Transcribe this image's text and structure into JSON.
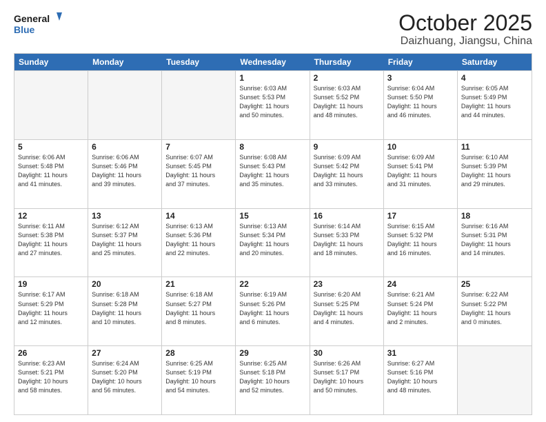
{
  "header": {
    "logo_line1": "General",
    "logo_line2": "Blue",
    "month": "October 2025",
    "location": "Daizhuang, Jiangsu, China"
  },
  "weekdays": [
    "Sunday",
    "Monday",
    "Tuesday",
    "Wednesday",
    "Thursday",
    "Friday",
    "Saturday"
  ],
  "weeks": [
    [
      {
        "day": "",
        "info": ""
      },
      {
        "day": "",
        "info": ""
      },
      {
        "day": "",
        "info": ""
      },
      {
        "day": "1",
        "info": "Sunrise: 6:03 AM\nSunset: 5:53 PM\nDaylight: 11 hours\nand 50 minutes."
      },
      {
        "day": "2",
        "info": "Sunrise: 6:03 AM\nSunset: 5:52 PM\nDaylight: 11 hours\nand 48 minutes."
      },
      {
        "day": "3",
        "info": "Sunrise: 6:04 AM\nSunset: 5:50 PM\nDaylight: 11 hours\nand 46 minutes."
      },
      {
        "day": "4",
        "info": "Sunrise: 6:05 AM\nSunset: 5:49 PM\nDaylight: 11 hours\nand 44 minutes."
      }
    ],
    [
      {
        "day": "5",
        "info": "Sunrise: 6:06 AM\nSunset: 5:48 PM\nDaylight: 11 hours\nand 41 minutes."
      },
      {
        "day": "6",
        "info": "Sunrise: 6:06 AM\nSunset: 5:46 PM\nDaylight: 11 hours\nand 39 minutes."
      },
      {
        "day": "7",
        "info": "Sunrise: 6:07 AM\nSunset: 5:45 PM\nDaylight: 11 hours\nand 37 minutes."
      },
      {
        "day": "8",
        "info": "Sunrise: 6:08 AM\nSunset: 5:43 PM\nDaylight: 11 hours\nand 35 minutes."
      },
      {
        "day": "9",
        "info": "Sunrise: 6:09 AM\nSunset: 5:42 PM\nDaylight: 11 hours\nand 33 minutes."
      },
      {
        "day": "10",
        "info": "Sunrise: 6:09 AM\nSunset: 5:41 PM\nDaylight: 11 hours\nand 31 minutes."
      },
      {
        "day": "11",
        "info": "Sunrise: 6:10 AM\nSunset: 5:39 PM\nDaylight: 11 hours\nand 29 minutes."
      }
    ],
    [
      {
        "day": "12",
        "info": "Sunrise: 6:11 AM\nSunset: 5:38 PM\nDaylight: 11 hours\nand 27 minutes."
      },
      {
        "day": "13",
        "info": "Sunrise: 6:12 AM\nSunset: 5:37 PM\nDaylight: 11 hours\nand 25 minutes."
      },
      {
        "day": "14",
        "info": "Sunrise: 6:13 AM\nSunset: 5:36 PM\nDaylight: 11 hours\nand 22 minutes."
      },
      {
        "day": "15",
        "info": "Sunrise: 6:13 AM\nSunset: 5:34 PM\nDaylight: 11 hours\nand 20 minutes."
      },
      {
        "day": "16",
        "info": "Sunrise: 6:14 AM\nSunset: 5:33 PM\nDaylight: 11 hours\nand 18 minutes."
      },
      {
        "day": "17",
        "info": "Sunrise: 6:15 AM\nSunset: 5:32 PM\nDaylight: 11 hours\nand 16 minutes."
      },
      {
        "day": "18",
        "info": "Sunrise: 6:16 AM\nSunset: 5:31 PM\nDaylight: 11 hours\nand 14 minutes."
      }
    ],
    [
      {
        "day": "19",
        "info": "Sunrise: 6:17 AM\nSunset: 5:29 PM\nDaylight: 11 hours\nand 12 minutes."
      },
      {
        "day": "20",
        "info": "Sunrise: 6:18 AM\nSunset: 5:28 PM\nDaylight: 11 hours\nand 10 minutes."
      },
      {
        "day": "21",
        "info": "Sunrise: 6:18 AM\nSunset: 5:27 PM\nDaylight: 11 hours\nand 8 minutes."
      },
      {
        "day": "22",
        "info": "Sunrise: 6:19 AM\nSunset: 5:26 PM\nDaylight: 11 hours\nand 6 minutes."
      },
      {
        "day": "23",
        "info": "Sunrise: 6:20 AM\nSunset: 5:25 PM\nDaylight: 11 hours\nand 4 minutes."
      },
      {
        "day": "24",
        "info": "Sunrise: 6:21 AM\nSunset: 5:24 PM\nDaylight: 11 hours\nand 2 minutes."
      },
      {
        "day": "25",
        "info": "Sunrise: 6:22 AM\nSunset: 5:22 PM\nDaylight: 11 hours\nand 0 minutes."
      }
    ],
    [
      {
        "day": "26",
        "info": "Sunrise: 6:23 AM\nSunset: 5:21 PM\nDaylight: 10 hours\nand 58 minutes."
      },
      {
        "day": "27",
        "info": "Sunrise: 6:24 AM\nSunset: 5:20 PM\nDaylight: 10 hours\nand 56 minutes."
      },
      {
        "day": "28",
        "info": "Sunrise: 6:25 AM\nSunset: 5:19 PM\nDaylight: 10 hours\nand 54 minutes."
      },
      {
        "day": "29",
        "info": "Sunrise: 6:25 AM\nSunset: 5:18 PM\nDaylight: 10 hours\nand 52 minutes."
      },
      {
        "day": "30",
        "info": "Sunrise: 6:26 AM\nSunset: 5:17 PM\nDaylight: 10 hours\nand 50 minutes."
      },
      {
        "day": "31",
        "info": "Sunrise: 6:27 AM\nSunset: 5:16 PM\nDaylight: 10 hours\nand 48 minutes."
      },
      {
        "day": "",
        "info": ""
      }
    ]
  ]
}
